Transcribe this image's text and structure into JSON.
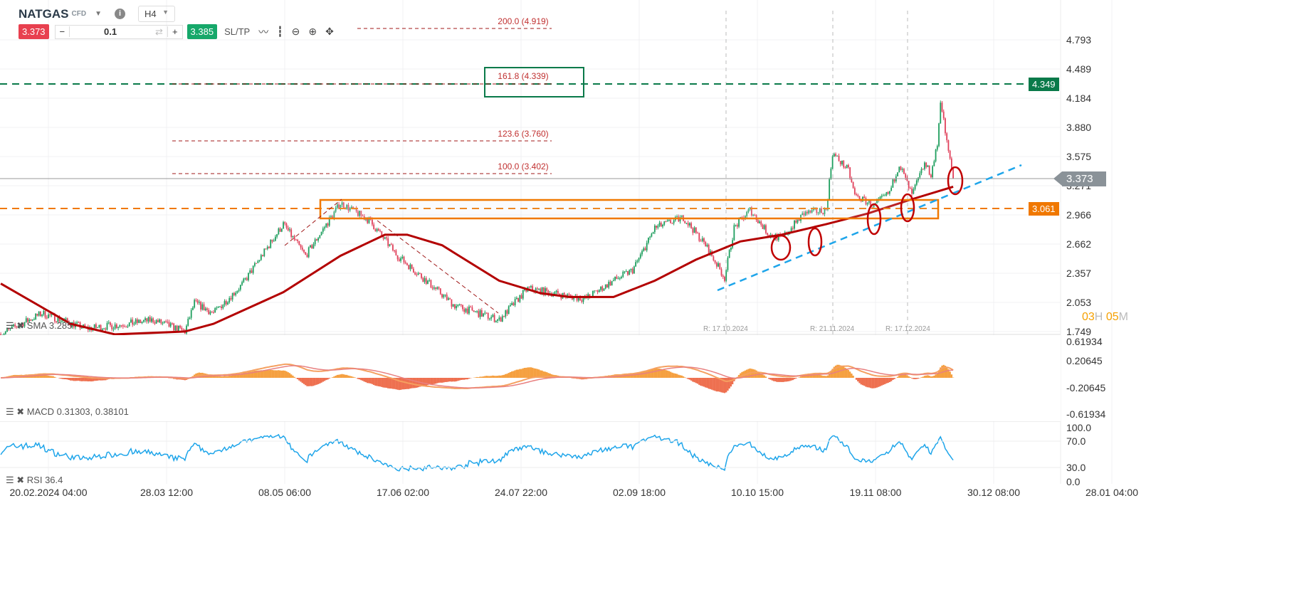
{
  "header": {
    "symbol": "NATGAS",
    "type": "CFD",
    "timeframe": "H4",
    "sell_price": "3.373",
    "buy_price": "3.385",
    "volume": "0.1",
    "sltp": "SL/TP",
    "minus": "−",
    "plus": "+"
  },
  "price_axis": [
    "4.793",
    "4.489",
    "4.184",
    "3.880",
    "3.575",
    "3.271",
    "2.966",
    "2.662",
    "2.357",
    "2.053",
    "1.749"
  ],
  "macd_axis": [
    "0.61934",
    "0.20645",
    "-0.20645",
    "-0.61934"
  ],
  "rsi_axis": [
    "100.0",
    "70.0",
    "30.0",
    "0.0"
  ],
  "time_axis": [
    "20.02.2024 04:00",
    "28.03 12:00",
    "08.05 06:00",
    "17.06 02:00",
    "24.07 22:00",
    "02.09 18:00",
    "10.10 15:00",
    "19.11 08:00",
    "30.12 08:00",
    "28.01 04:00"
  ],
  "fib": [
    "200.0 (4.919)",
    "161.8 (4.339)",
    "123.6 (3.760)",
    "100.0 (3.402)"
  ],
  "levels": {
    "green": "4.349",
    "orange": "3.061",
    "current": "3.373"
  },
  "colors": {
    "green": "#0a7a4a",
    "orange": "#f07800",
    "red": "#c00000",
    "blue": "#1ea5ea",
    "up": "#1e9e5e",
    "down": "#e0405a"
  },
  "rollovers": [
    "R: 17.10.2024",
    "R: 21.11.2024",
    "R: 17.12.2024"
  ],
  "countdown": {
    "h": "03",
    "hl": "H",
    "m": "05",
    "ml": "M"
  },
  "indicators": {
    "sma": "SMA 3.285",
    "macd": "MACD 0.31303, 0.38101",
    "rsi": "RSI 36.4"
  },
  "chart_data": {
    "type": "candlestick",
    "x_unit": "days since 20.02.2024",
    "price_path": [
      [
        -15,
        1.72
      ],
      [
        -2,
        1.94
      ],
      [
        12,
        1.78
      ],
      [
        25,
        1.83
      ],
      [
        33,
        1.87
      ],
      [
        43,
        1.75
      ],
      [
        46,
        2.05
      ],
      [
        52,
        1.94
      ],
      [
        61,
        2.24
      ],
      [
        74,
        2.87
      ],
      [
        81,
        2.54
      ],
      [
        92,
        3.09
      ],
      [
        101,
        2.91
      ],
      [
        110,
        2.54
      ],
      [
        119,
        2.28
      ],
      [
        128,
        2.02
      ],
      [
        142,
        1.87
      ],
      [
        151,
        2.2
      ],
      [
        162,
        2.13
      ],
      [
        169,
        2.09
      ],
      [
        178,
        2.28
      ],
      [
        184,
        2.39
      ],
      [
        187,
        2.57
      ],
      [
        191,
        2.83
      ],
      [
        200,
        2.94
      ],
      [
        207,
        2.65
      ],
      [
        213,
        2.31
      ],
      [
        216,
        2.83
      ],
      [
        221,
        3.02
      ],
      [
        227,
        2.76
      ],
      [
        231,
        2.72
      ],
      [
        238,
        2.98
      ],
      [
        245,
        3.02
      ],
      [
        247,
        3.61
      ],
      [
        252,
        3.43
      ],
      [
        254,
        3.17
      ],
      [
        260,
        3.06
      ],
      [
        265,
        3.2
      ],
      [
        268,
        3.5
      ],
      [
        272,
        3.17
      ],
      [
        276,
        3.5
      ],
      [
        278,
        3.39
      ],
      [
        280,
        3.69
      ],
      [
        281,
        4.17
      ],
      [
        283,
        3.72
      ],
      [
        285,
        3.35
      ]
    ],
    "sma_path": [
      [
        -15,
        2.25
      ],
      [
        7,
        1.83
      ],
      [
        21,
        1.72
      ],
      [
        43,
        1.75
      ],
      [
        52,
        1.83
      ],
      [
        74,
        2.16
      ],
      [
        92,
        2.54
      ],
      [
        106,
        2.76
      ],
      [
        113,
        2.76
      ],
      [
        124,
        2.65
      ],
      [
        142,
        2.28
      ],
      [
        155,
        2.15
      ],
      [
        164,
        2.11
      ],
      [
        178,
        2.11
      ],
      [
        191,
        2.28
      ],
      [
        204,
        2.5
      ],
      [
        218,
        2.69
      ],
      [
        231,
        2.76
      ],
      [
        245,
        2.87
      ],
      [
        258,
        2.98
      ],
      [
        272,
        3.13
      ],
      [
        285,
        3.26
      ]
    ],
    "ylim": [
      1.749,
      4.793
    ]
  }
}
